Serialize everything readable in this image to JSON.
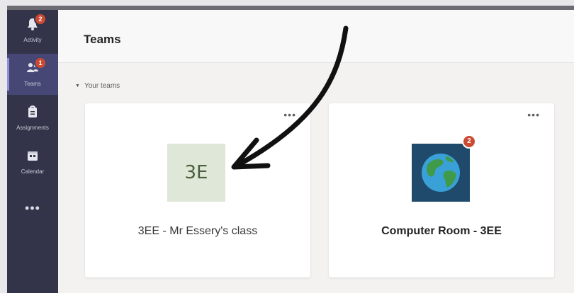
{
  "app": {
    "accent": "#464775",
    "rail_color": "#33344a",
    "badge_color": "#cc4a31"
  },
  "rail": {
    "items": [
      {
        "label": "Activity",
        "icon": "bell-icon",
        "badge": "2"
      },
      {
        "label": "Teams",
        "icon": "teams-icon",
        "badge": "1",
        "active": true
      },
      {
        "label": "Assignments",
        "icon": "assignments-icon"
      },
      {
        "label": "Calendar",
        "icon": "calendar-icon"
      }
    ],
    "more": "•••"
  },
  "header": {
    "title": "Teams"
  },
  "section": {
    "label": "Your teams"
  },
  "teams": [
    {
      "name": "3EE - Mr Essery's class",
      "avatar_text": "3E",
      "more": "•••"
    },
    {
      "name": "Computer Room - 3EE",
      "avatar_icon": "globe-icon",
      "badge": "2",
      "more": "•••"
    }
  ]
}
